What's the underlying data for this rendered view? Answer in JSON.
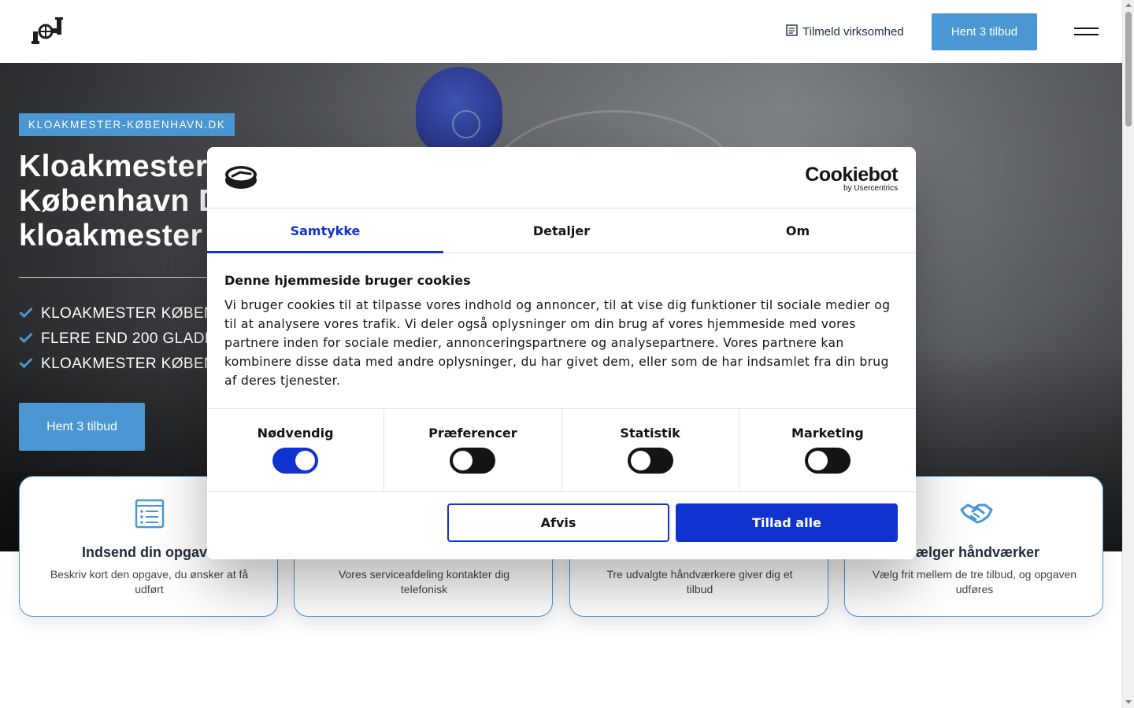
{
  "header": {
    "logo_icon": "plumbing-pipe-logo",
    "signup_label": "Tilmeld virksomhed",
    "signup_icon": "form-icon",
    "cta_label": "Hent 3 tilbud",
    "menu_icon": "hamburger-icon"
  },
  "hero": {
    "badge": "KLOAKMESTER-KØBENHAVN.DK",
    "title_lines": [
      "Kloakmester",
      "København Di",
      "kloakmester"
    ],
    "list": [
      "KLOAKMESTER KØBENH",
      "FLERE END 200 GLADE K",
      "KLOAKMESTER KØBENH"
    ],
    "list_icon": "check-icon",
    "cta_label": "Hent 3 tilbud"
  },
  "steps": [
    {
      "icon": "form-list-icon",
      "title": "Indsend din opgave",
      "text": "Beskriv kort den opgave, du ønsker at få udført"
    },
    {
      "icon": "phone-icon",
      "title": "",
      "text": "Vores serviceafdeling kontakter dig telefonisk"
    },
    {
      "icon": "offers-icon",
      "title": "",
      "text": "Tre udvalgte håndværkere giver dig et tilbud"
    },
    {
      "icon": "handshake-icon",
      "title": "vælger håndværker",
      "text": "Vælg frit mellem de tre tilbud, og opgaven udføres"
    }
  ],
  "cookie": {
    "brand_name": "Cookiebot",
    "brand_by": "by Usercentrics",
    "tabs": [
      "Samtykke",
      "Detaljer",
      "Om"
    ],
    "active_tab": "Samtykke",
    "heading": "Denne hjemmeside bruger cookies",
    "body": "Vi bruger cookies til at tilpasse vores indhold og annoncer, til at vise dig funktioner til sociale medier og til at analysere vores trafik. Vi deler også oplysninger om din brug af vores hjemmeside med vores partnere inden for sociale medier, annonceringspartnere og analysepartnere. Vores partnere kan kombinere disse data med andre oplysninger, du har givet dem, eller som de har indsamlet fra din brug af deres tjenester.",
    "categories": [
      {
        "label": "Nødvendig",
        "enabled": true
      },
      {
        "label": "Præferencer",
        "enabled": false
      },
      {
        "label": "Statistik",
        "enabled": false
      },
      {
        "label": "Marketing",
        "enabled": false
      }
    ],
    "deny_label": "Afvis",
    "allow_label": "Tillad alle"
  },
  "colors": {
    "accent": "#4a97d3",
    "cookie_primary": "#1032cf",
    "text_dark": "#1f2b3a"
  }
}
